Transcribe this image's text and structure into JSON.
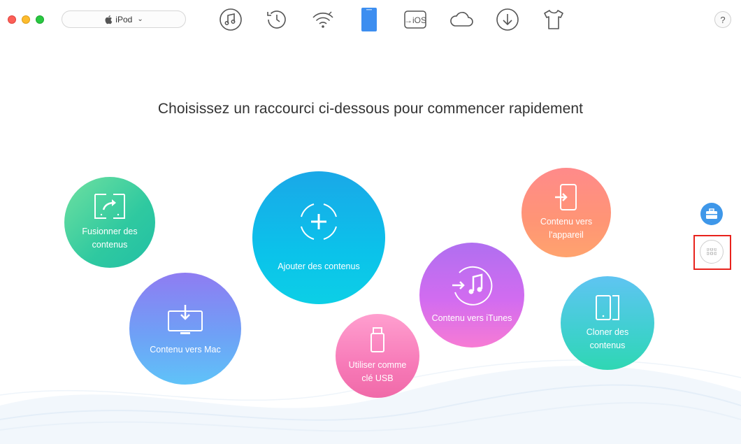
{
  "window": {
    "device_name": "iPod"
  },
  "toolbar": {
    "icons": [
      "music-icon",
      "history-icon",
      "wifi-icon",
      "device-icon",
      "to-ios-icon",
      "cloud-icon",
      "download-icon",
      "shirt-icon"
    ],
    "to_ios_text": "→iOS",
    "help_label": "?"
  },
  "main": {
    "headline": "Choisissez un raccourci ci-dessous pour commencer rapidement",
    "shortcuts": {
      "merge": {
        "line1": "Fusionner des",
        "line2": "contenus"
      },
      "to_mac": {
        "line1": "Contenu vers Mac",
        "line2": ""
      },
      "add": {
        "line1": "Ajouter des contenus",
        "line2": ""
      },
      "usb": {
        "line1": "Utiliser comme",
        "line2": "clé USB"
      },
      "to_itunes": {
        "line1": "Contenu vers iTunes",
        "line2": ""
      },
      "to_device": {
        "line1": "Contenu vers",
        "line2": "l'appareil"
      },
      "clone": {
        "line1": "Cloner des",
        "line2": "contenus"
      }
    }
  },
  "colors": {
    "accent": "#1aa8e8",
    "highlight_frame": "#e8231d",
    "toolbox_button": "#3e97e9"
  }
}
